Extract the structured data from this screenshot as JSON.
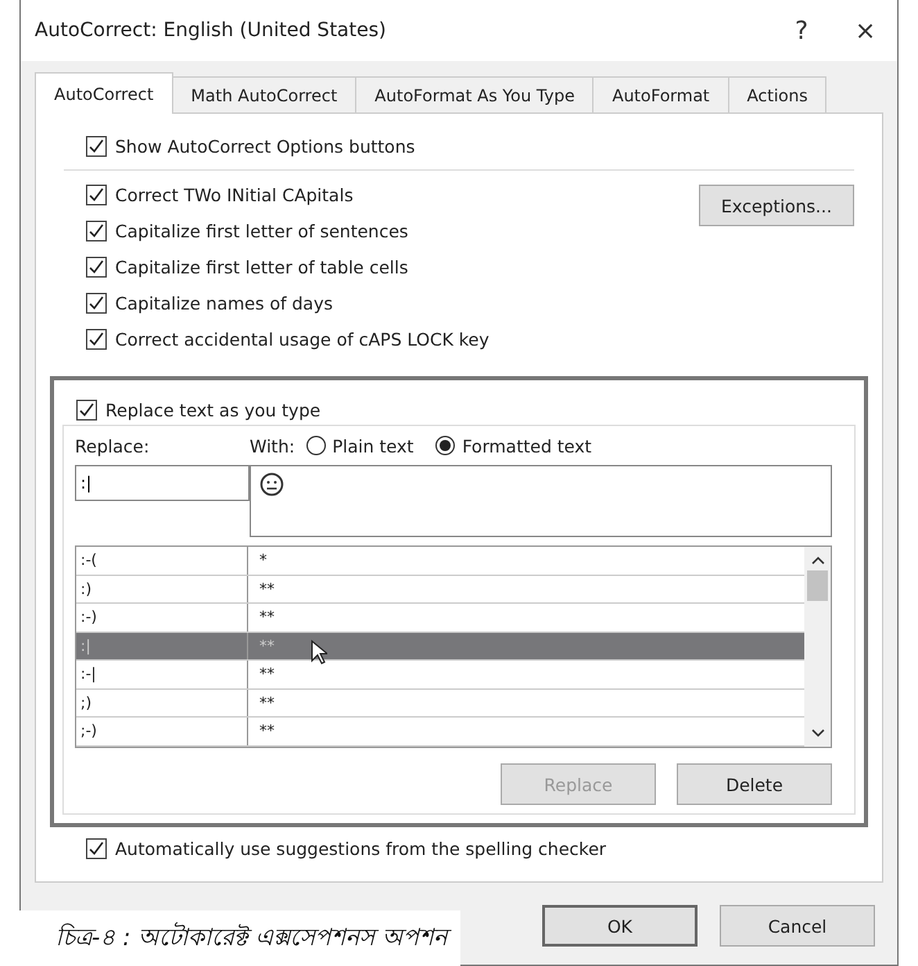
{
  "window": {
    "title": "AutoCorrect: English (United States)",
    "help": "?",
    "close": "×"
  },
  "tabs": [
    {
      "label": "AutoCorrect",
      "selected": true
    },
    {
      "label": "Math AutoCorrect",
      "selected": false
    },
    {
      "label": "AutoFormat As You Type",
      "selected": false
    },
    {
      "label": "AutoFormat",
      "selected": false
    },
    {
      "label": "Actions",
      "selected": false
    }
  ],
  "show_options": {
    "label": "Show AutoCorrect Options buttons",
    "checked": true
  },
  "options": [
    {
      "label": "Correct TWo INitial CApitals",
      "checked": true
    },
    {
      "label": "Capitalize first letter of sentences",
      "checked": true
    },
    {
      "label": "Capitalize first letter of table cells",
      "checked": true
    },
    {
      "label": "Capitalize names of days",
      "checked": true
    },
    {
      "label": "Correct accidental usage of cAPS LOCK key",
      "checked": true
    }
  ],
  "exceptions_button": "Exceptions...",
  "replace_group": {
    "label": "Replace text as you type",
    "checked": true,
    "replace_label": "Replace:",
    "with_label": "With:",
    "format_options": [
      {
        "label": "Plain text",
        "selected": false
      },
      {
        "label": "Formatted text",
        "selected": true
      }
    ],
    "replace_value": ":|",
    "rows": [
      {
        "replace": ":-(",
        "with": "*",
        "selected": false
      },
      {
        "replace": ":)",
        "with": "**",
        "selected": false
      },
      {
        "replace": ":-)",
        "with": "**",
        "selected": false
      },
      {
        "replace": ":|",
        "with": "**",
        "selected": true
      },
      {
        "replace": ":-|",
        "with": "**",
        "selected": false
      },
      {
        "replace": ";)",
        "with": "**",
        "selected": false
      },
      {
        "replace": ";-)",
        "with": "**",
        "selected": false
      }
    ],
    "replace_button": {
      "label": "Replace",
      "disabled": true
    },
    "delete_button": {
      "label": "Delete",
      "disabled": false
    }
  },
  "suggestions": {
    "label": "Automatically use suggestions from the spelling checker",
    "checked": true
  },
  "buttons": [
    "OK",
    "Cancel"
  ],
  "caption": "চিত্র-৪ : অটোকারেক্ট এক্সসেপশনস অপশন"
}
